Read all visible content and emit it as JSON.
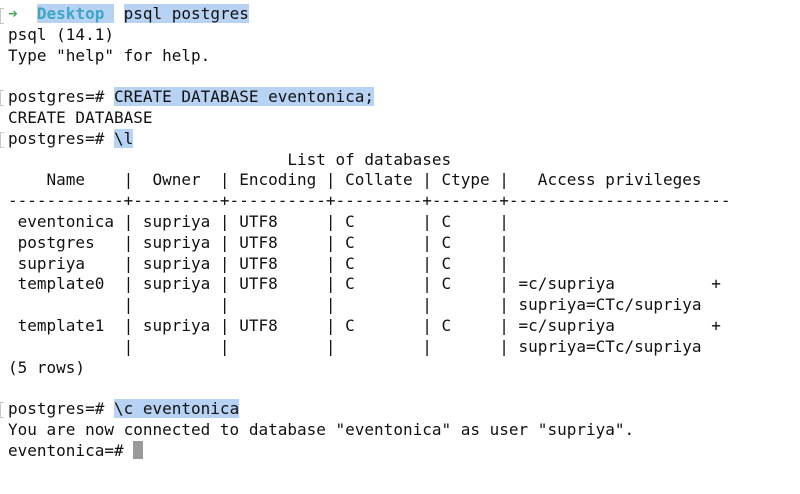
{
  "terminal": {
    "prompt": {
      "arrow": "➜",
      "directory": "Desktop",
      "command": "psql postgres"
    },
    "lines": {
      "version": "psql (14.1)",
      "help": "Type \"help\" for help.",
      "create_prompt": "postgres=#",
      "create_cmd": "CREATE DATABASE eventonica;",
      "create_result": "CREATE DATABASE",
      "list_prompt": "postgres=#",
      "list_cmd": "\\l",
      "rows_count": "(5 rows)",
      "connect_prompt": "postgres=#",
      "connect_cmd": "\\c eventonica",
      "connect_result": "You are now connected to database \"eventonica\" as user \"supriya\".",
      "final_prompt": "eventonica=#"
    },
    "db_table": {
      "title": "                             List of databases",
      "header": "    Name    |  Owner  | Encoding | Collate | Ctype |   Access privileges",
      "separator": "------------+---------+----------+---------+-------+-----------------------",
      "rows": [
        " eventonica | supriya | UTF8     | C       | C     |",
        " postgres   | supriya | UTF8     | C       | C     |",
        " supriya    | supriya | UTF8     | C       | C     |",
        " template0  | supriya | UTF8     | C       | C     | =c/supriya          +",
        "            |         |          |         |       | supriya=CTc/supriya",
        " template1  | supriya | UTF8     | C       | C     | =c/supriya          +",
        "            |         |          |         |       | supriya=CTc/supriya"
      ]
    }
  }
}
